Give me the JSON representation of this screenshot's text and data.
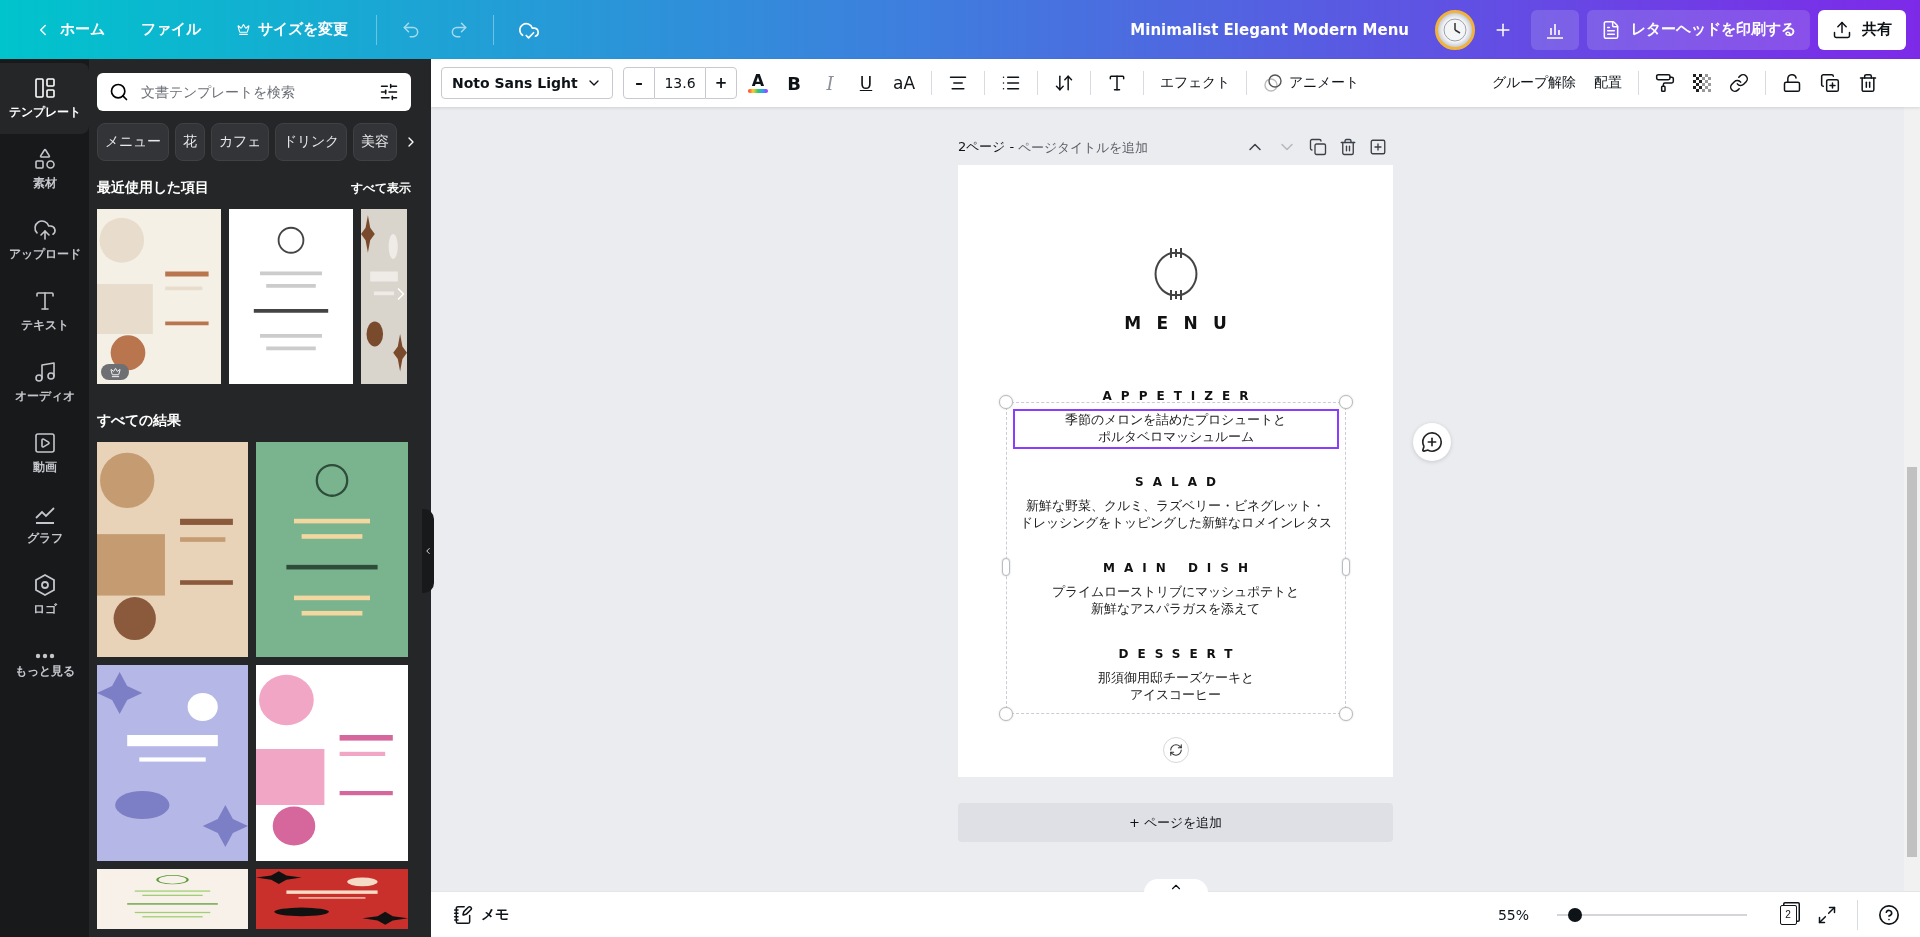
{
  "topbar": {
    "back": "ホーム",
    "file": "ファイル",
    "resize": "サイズを変更",
    "doc_title": "Minimalist Elegant Modern Menu",
    "print_button": "レターヘッドを印刷する",
    "share_button": "共有"
  },
  "rail": [
    {
      "kind": "templates",
      "label": "テンプレート",
      "selected": true
    },
    {
      "kind": "elements",
      "label": "素材",
      "selected": false
    },
    {
      "kind": "uploads",
      "label": "アップロード",
      "selected": false
    },
    {
      "kind": "text",
      "label": "テキスト",
      "selected": false
    },
    {
      "kind": "audio",
      "label": "オーディオ",
      "selected": false
    },
    {
      "kind": "video",
      "label": "動画",
      "selected": false
    },
    {
      "kind": "charts",
      "label": "グラフ",
      "selected": false
    },
    {
      "kind": "logos",
      "label": "ロゴ",
      "selected": false
    },
    {
      "kind": "more",
      "label": "もっと見る",
      "selected": false
    }
  ],
  "panel": {
    "search": {
      "placeholder": "文書テンプレートを検索"
    },
    "chips": [
      "メニュー",
      "花",
      "カフェ",
      "ドリンク",
      "美容"
    ],
    "recent_heading": "最近使用した項目",
    "see_all": "すべて表示",
    "recent": [
      {
        "kind": "picture",
        "premium": true
      },
      {
        "kind": "picture",
        "premium": false
      },
      {
        "kind": "picture",
        "premium": false
      }
    ],
    "results_heading": "すべての結果",
    "results": [
      {
        "kind": "picture"
      },
      {
        "kind": "picture"
      },
      {
        "kind": "picture"
      },
      {
        "kind": "picture"
      },
      {
        "kind": "picture"
      },
      {
        "kind": "picture"
      }
    ]
  },
  "toolbar": {
    "font": "Noto Sans Light",
    "minus": "–",
    "size": "13.6",
    "plus": "+",
    "color_letter": "A",
    "bold": "B",
    "italic": "I",
    "underline": "U",
    "case": "aA",
    "effects": "エフェクト",
    "animate": "アニメート",
    "ungroup": "グループ解除",
    "position": "配置"
  },
  "canvas": {
    "page_number": "2ページ",
    "separator": " - ",
    "page_title_placeholder": "ページタイトルを追加",
    "design": {
      "title": "MENU",
      "sections": [
        {
          "heading": "APPETIZER",
          "lines": [
            "季節のメロンを詰めたプロシュートと",
            "ポルタベロマッシュルーム"
          ],
          "selected": true
        },
        {
          "heading": "SALAD",
          "lines": [
            "新鮮な野菜、クルミ、ラズベリー・ビネグレット・",
            "ドレッシングをトッピングした新鮮なロメインレタス"
          ],
          "selected": false
        },
        {
          "heading": "MAIN DISH",
          "lines": [
            "プライムローストリブにマッシュポテトと",
            "新鮮なアスパラガスを添えて"
          ],
          "selected": false
        },
        {
          "heading": "DESSERT",
          "lines": [
            "那須御用邸チーズケーキと",
            "アイスコーヒー"
          ],
          "selected": false
        }
      ]
    },
    "add_page_plus": "+",
    "add_page": "ページを追加"
  },
  "bottombar": {
    "notes": "メモ",
    "zoom": "55%",
    "zoom_slider": {
      "level": 0.06
    },
    "page_count": "2"
  }
}
